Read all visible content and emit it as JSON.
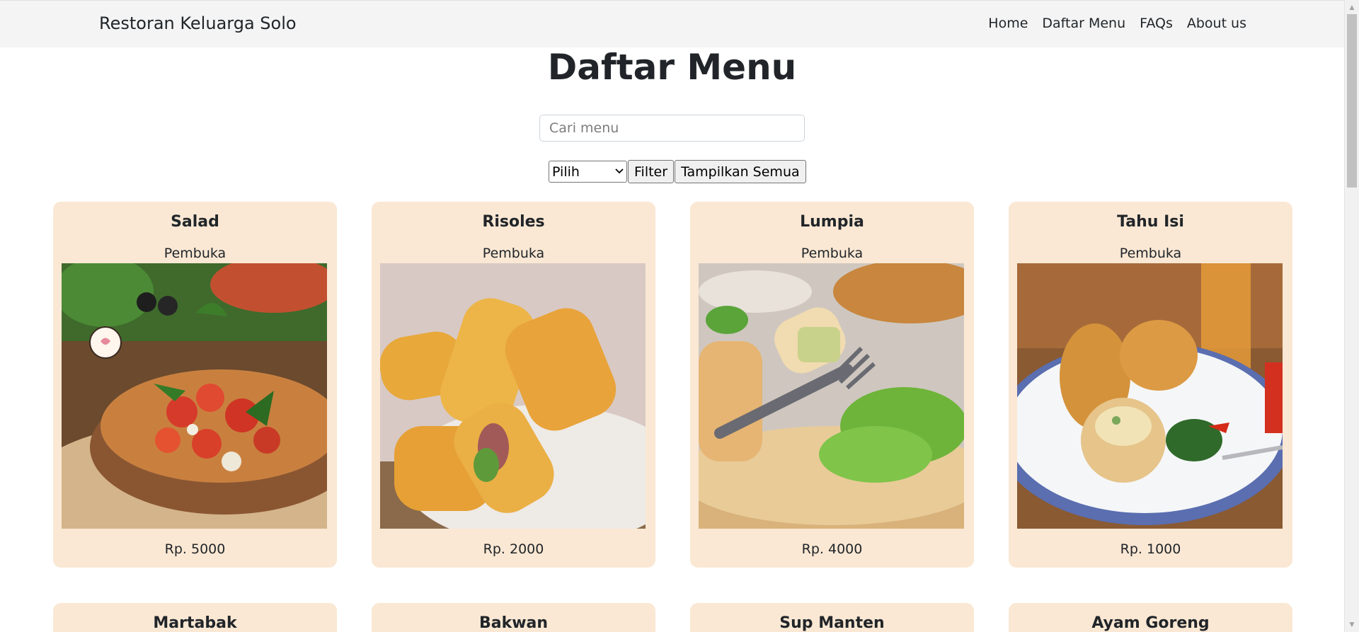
{
  "navbar": {
    "brand": "Restoran Keluarga Solo",
    "links": [
      "Home",
      "Daftar Menu",
      "FAQs",
      "About us"
    ]
  },
  "page": {
    "title": "Daftar Menu",
    "search_placeholder": "Cari menu",
    "select_value": "Pilih",
    "filter_label": "Filter",
    "show_all_label": "Tampilkan Semua"
  },
  "menu": [
    {
      "name": "Salad",
      "category": "Pembuka",
      "price": "Rp. 5000"
    },
    {
      "name": "Risoles",
      "category": "Pembuka",
      "price": "Rp. 2000"
    },
    {
      "name": "Lumpia",
      "category": "Pembuka",
      "price": "Rp. 4000"
    },
    {
      "name": "Tahu Isi",
      "category": "Pembuka",
      "price": "Rp. 1000"
    },
    {
      "name": "Martabak"
    },
    {
      "name": "Bakwan"
    },
    {
      "name": "Sup Manten"
    },
    {
      "name": "Ayam Goreng"
    }
  ],
  "colors": {
    "card_bg": "#fae8d4",
    "navbar_bg": "#f4f4f4",
    "text": "#212529"
  }
}
